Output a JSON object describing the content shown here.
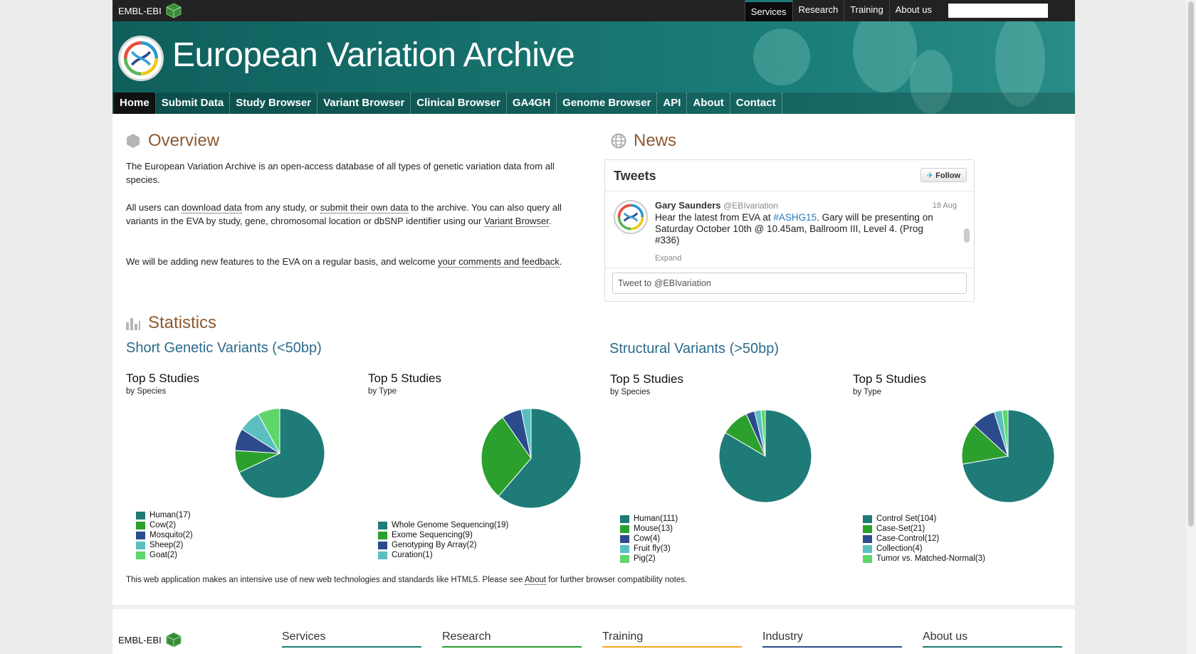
{
  "global_header": {
    "logo_text": "EMBL-EBI",
    "nav": [
      "Services",
      "Research",
      "Training",
      "About us"
    ],
    "search_placeholder": ""
  },
  "masthead": {
    "title": "European Variation Archive",
    "nav": [
      "Home",
      "Submit Data",
      "Study Browser",
      "Variant Browser",
      "Clinical Browser",
      "GA4GH",
      "Genome Browser",
      "API",
      "About",
      "Contact"
    ],
    "active_nav": "Home"
  },
  "overview": {
    "heading": "Overview",
    "p1": "The European Variation Archive is an open-access database of all types of genetic variation data from all species.",
    "p2_a": "All users can ",
    "p2_link1": "download data",
    "p2_b": " from any study, or ",
    "p2_link2": "submit their own data",
    "p2_c": " to the archive. You can also query all variants in the EVA by study, gene, chromosomal location or dbSNP identifier using our ",
    "p2_link3": "Variant Browser",
    "p2_d": ".",
    "p3_a": "We will be adding new features to the EVA on a regular basis, and welcome ",
    "p3_link": "your comments and feedback",
    "p3_b": "."
  },
  "news": {
    "heading": "News",
    "widget_title": "Tweets",
    "follow_label": "Follow",
    "tweet": {
      "author": "Gary Saunders",
      "handle": "@EBIvariation",
      "date": "18 Aug",
      "text_a": "Hear the latest from EVA at ",
      "hashtag": "#ASHG15",
      "text_b": ". Gary will be presenting on Saturday October 10th @ 10.45am, Ballroom III, Level 4. (Prog #336)",
      "expand": "Expand"
    },
    "tweet_box_placeholder": "Tweet to @EBIvariation"
  },
  "statistics": {
    "heading": "Statistics",
    "short_heading": "Short Genetic Variants (<50bp)",
    "structural_heading": "Structural Variants (>50bp)"
  },
  "colors": {
    "teal": "#1f7b77",
    "green": "#2ca02c",
    "navy": "#2b4b8c",
    "aqua": "#5bbfc0",
    "lightgreen": "#5ed66a",
    "brown_heading": "#8c5a32",
    "blue_heading": "#2b6b8b"
  },
  "chart_data": [
    {
      "type": "pie",
      "title": "Top 5 Studies",
      "subtitle": "by Species",
      "categories": [
        "Human",
        "Cow",
        "Mosquito",
        "Sheep",
        "Goat"
      ],
      "values": [
        17,
        2,
        2,
        2,
        2
      ],
      "legend": [
        "Human(17)",
        "Cow(2)",
        "Mosquito(2)",
        "Sheep(2)",
        "Goat(2)"
      ]
    },
    {
      "type": "pie",
      "title": "Top 5 Studies",
      "subtitle": "by Type",
      "categories": [
        "Whole Genome Sequencing",
        "Exome Sequencing",
        "Genotyping By Array",
        "Curation"
      ],
      "values": [
        19,
        9,
        2,
        1
      ],
      "legend": [
        "Whole Genome Sequencing(19)",
        "Exome Sequencing(9)",
        "Genotyping By Array(2)",
        "Curation(1)"
      ]
    },
    {
      "type": "pie",
      "title": "Top 5 Studies",
      "subtitle": "by Species",
      "categories": [
        "Human",
        "Mouse",
        "Cow",
        "Fruit fly",
        "Pig"
      ],
      "values": [
        111,
        13,
        4,
        3,
        2
      ],
      "legend": [
        "Human(111)",
        "Mouse(13)",
        "Cow(4)",
        "Fruit fly(3)",
        "Pig(2)"
      ]
    },
    {
      "type": "pie",
      "title": "Top 5 Studies",
      "subtitle": "by Type",
      "categories": [
        "Control Set",
        "Case-Set",
        "Case-Control",
        "Collection",
        "Tumor vs. Matched-Normal"
      ],
      "values": [
        104,
        21,
        12,
        4,
        3
      ],
      "legend": [
        "Control Set(104)",
        "Case-Set(21)",
        "Case-Control(12)",
        "Collection(4)",
        "Tumor vs. Matched-Normal(3)"
      ]
    }
  ],
  "compat_note": {
    "text_a": "This web application makes an intensive use of new web technologies and standards like HTML5. Please see ",
    "link": "About",
    "text_b": " for further browser compatibility notes."
  },
  "footer": {
    "logo_text": "EMBL-EBI",
    "columns": [
      "Services",
      "Research",
      "Training",
      "Industry",
      "About us"
    ],
    "column_colors": [
      "#1f7b77",
      "#2ca02c",
      "#f5a623",
      "#2b4b8c",
      "#1f7b77"
    ]
  }
}
